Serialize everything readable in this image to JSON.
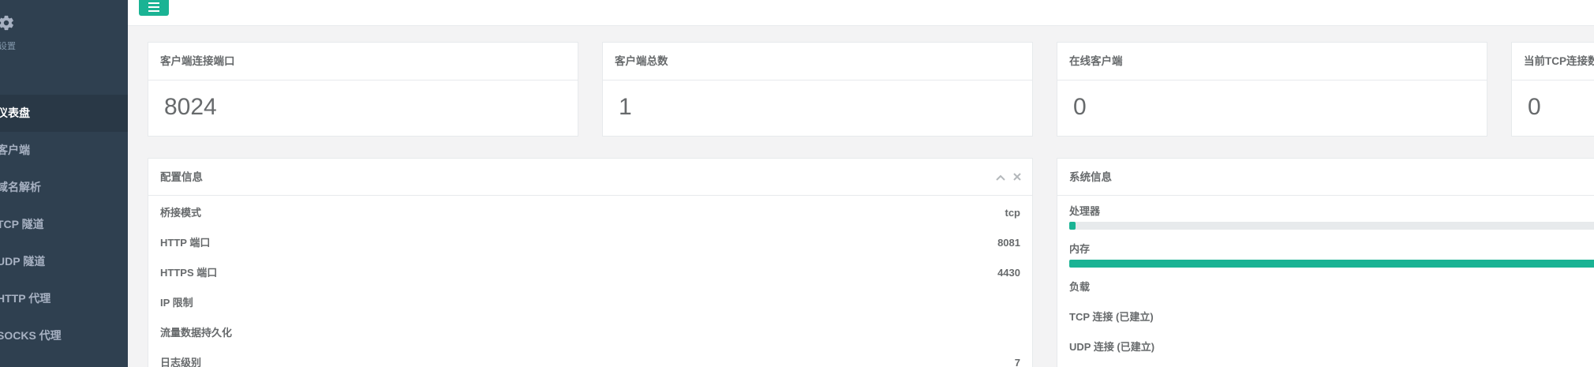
{
  "sidebar": {
    "gear_label": "设置",
    "items": [
      {
        "label": "仪表盘",
        "active": true
      },
      {
        "label": "客户端",
        "active": false
      },
      {
        "label": "域名解析",
        "active": false
      },
      {
        "label": "TCP 隧道",
        "active": false
      },
      {
        "label": "UDP 隧道",
        "active": false
      },
      {
        "label": "HTTP 代理",
        "active": false
      },
      {
        "label": "SOCKS 代理",
        "active": false
      }
    ]
  },
  "topbar": {
    "menu_icon": "hamburger-menu-icon"
  },
  "stats": [
    {
      "title": "客户端连接端口",
      "value": "8024"
    },
    {
      "title": "客户端总数",
      "value": "1"
    },
    {
      "title": "在线客户端",
      "value": "0"
    },
    {
      "title": "当前TCP连接数",
      "value": "0"
    }
  ],
  "config_panel": {
    "title": "配置信息",
    "rows": [
      {
        "label": "桥接模式",
        "value": "tcp"
      },
      {
        "label": "HTTP 端口",
        "value": "8081"
      },
      {
        "label": "HTTPS 端口",
        "value": "4430"
      },
      {
        "label": "IP 限制",
        "value": ""
      },
      {
        "label": "流量数据持久化",
        "value": ""
      },
      {
        "label": "日志级别",
        "value": "7"
      }
    ]
  },
  "system_panel": {
    "title": "系统信息",
    "cpu_label": "处理器",
    "cpu_percent": 1,
    "memory_label": "内存",
    "memory_percent": 100,
    "load_label": "负载",
    "tcp_label": "TCP 连接 (已建立)",
    "udp_label": "UDP 连接 (已建立)"
  },
  "colors": {
    "accent": "#1ab394",
    "sidebar": "#2f4050",
    "sidebar_active": "#293846"
  }
}
